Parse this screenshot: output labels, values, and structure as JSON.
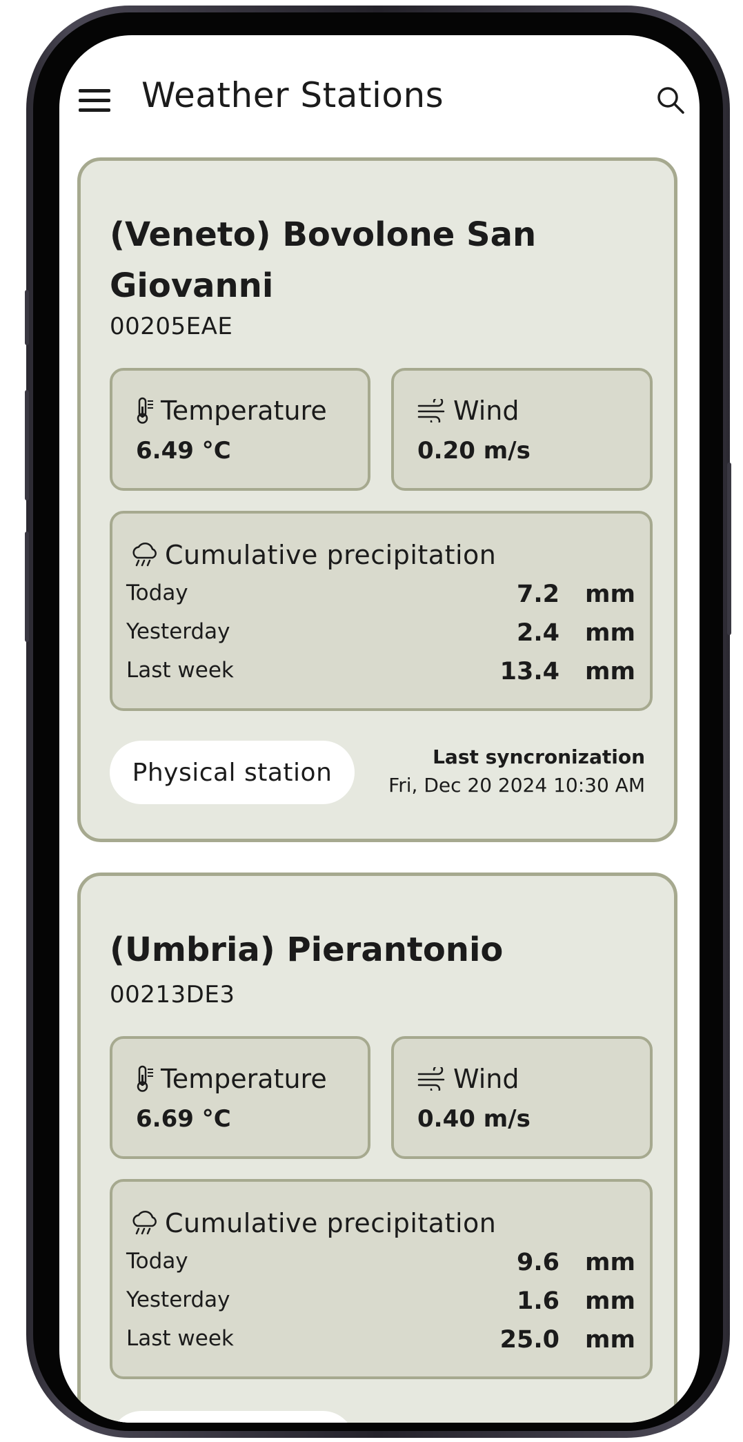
{
  "appbar": {
    "title": "Weather Stations"
  },
  "icons": {
    "menu": "hamburger-menu-icon",
    "search": "search-icon",
    "temperature": "thermometer-icon",
    "wind": "wind-icon",
    "precipitation": "cloud-rain-icon"
  },
  "colors": {
    "card_bg": "#e6e8df",
    "card_border": "#a6a98f",
    "tile_bg": "#d9dacd"
  },
  "stations": [
    {
      "name": "(Veneto) Bovolone San Giovanni",
      "code": "00205EAE",
      "temperature": {
        "label": "Temperature",
        "value": "6.49 °C"
      },
      "wind": {
        "label": "Wind",
        "value": "0.20 m/s"
      },
      "precipitation": {
        "title": "Cumulative precipitation",
        "rows": [
          {
            "label": "Today",
            "value": "7.2",
            "unit": "mm"
          },
          {
            "label": "Yesterday",
            "value": "2.4",
            "unit": "mm"
          },
          {
            "label": "Last week",
            "value": "13.4",
            "unit": "mm"
          }
        ]
      },
      "type_chip": "Physical station",
      "sync": {
        "title": "Last syncronization",
        "date": "Fri, Dec 20 2024 10:30 AM"
      }
    },
    {
      "name": "(Umbria) Pierantonio",
      "code": "00213DE3",
      "temperature": {
        "label": "Temperature",
        "value": "6.69 °C"
      },
      "wind": {
        "label": "Wind",
        "value": "0.40 m/s"
      },
      "precipitation": {
        "title": "Cumulative precipitation",
        "rows": [
          {
            "label": "Today",
            "value": "9.6",
            "unit": "mm"
          },
          {
            "label": "Yesterday",
            "value": "1.6",
            "unit": "mm"
          },
          {
            "label": "Last week",
            "value": "25.0",
            "unit": "mm"
          }
        ]
      }
    }
  ]
}
